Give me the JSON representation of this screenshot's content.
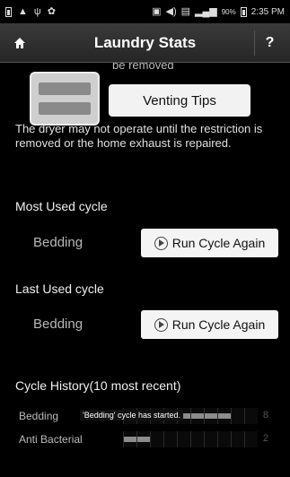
{
  "status_bar": {
    "time": "2:35 PM",
    "battery_text": "90%",
    "left_icons": [
      "battery-alert-icon",
      "warning-icon",
      "usb-icon",
      "android-icon"
    ],
    "right_icons": [
      "sim-icon",
      "volume-icon",
      "sd-icon",
      "signal-icon"
    ]
  },
  "header": {
    "title": "Laundry Stats",
    "help_label": "?"
  },
  "venting": {
    "partial_text": "be removed",
    "button_label": "Venting Tips",
    "warning_text": "The dryer may not operate until the restriction is removed or the home exhaust is repaired."
  },
  "most_used": {
    "label": "Most Used cycle",
    "cycle": "Bedding",
    "button_label": "Run Cycle Again"
  },
  "last_used": {
    "label": "Last Used cycle",
    "cycle": "Bedding",
    "button_label": "Run Cycle Again"
  },
  "history": {
    "label": "Cycle History(10 most recent)",
    "rows": [
      {
        "name": "Bedding",
        "count": "8",
        "level": 0.8
      },
      {
        "name": "Anti Bacterial",
        "count": "2",
        "level": 0.2
      }
    ],
    "toast": "'Bedding' cycle has started."
  },
  "colors": {
    "background": "#000000",
    "button": "#f2f2f2",
    "title_bar": "#2e2e2e"
  }
}
